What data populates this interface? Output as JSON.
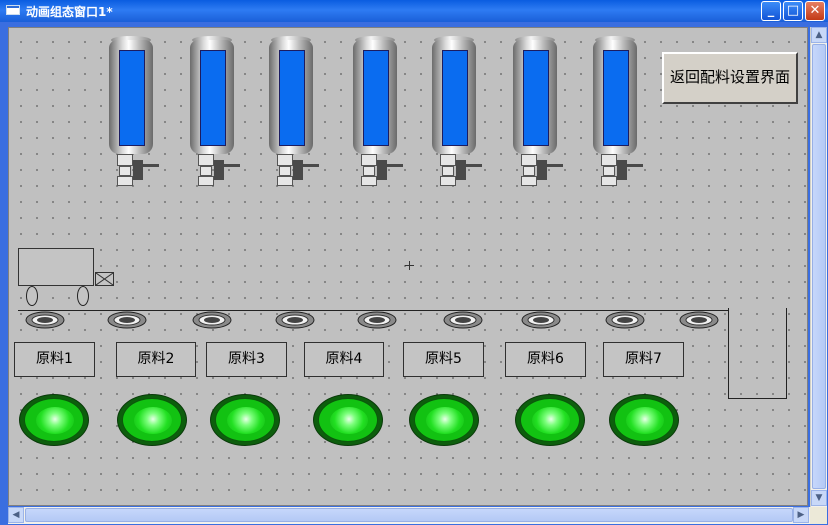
{
  "window": {
    "title": "动画组态窗口1*",
    "min_glyph": "_",
    "max_glyph": "□",
    "close_glyph": "✕"
  },
  "canvas": {
    "tanks_count": 7,
    "return_button": "返回配料设置界面",
    "materials": [
      "原料1",
      "原料2",
      "原料3",
      "原料4",
      "原料5",
      "原料6",
      "原料7"
    ],
    "colors": {
      "background": "#c0c0c0",
      "tank_level": "#0a6cf0",
      "lamp_on": "#22e022"
    }
  },
  "icons": {
    "window_icon": "window-icon",
    "truck": "truck-icon",
    "roller": "roller-icon",
    "lamp": "indicator-lamp-icon"
  },
  "scrollbars": {
    "v_up": "▲",
    "v_down": "▼",
    "h_left": "◀",
    "h_right": "▶"
  }
}
